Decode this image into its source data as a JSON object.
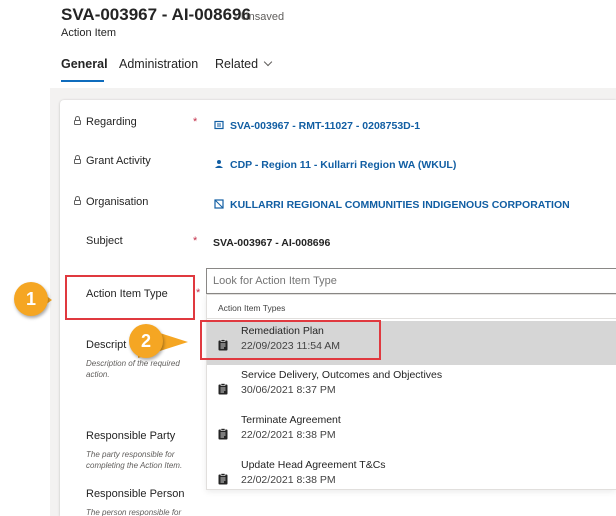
{
  "record": {
    "title": "SVA-003967 - AI-008696",
    "status": "- Unsaved",
    "entity": "Action Item"
  },
  "tabs": [
    {
      "label": "General"
    },
    {
      "label": "Administration"
    },
    {
      "label": "Related"
    }
  ],
  "fields": {
    "regarding": {
      "label": "Regarding",
      "value": "SVA-003967 - RMT-11027 - 0208753D-1",
      "icon": "record-icon"
    },
    "grant_activity": {
      "label": "Grant Activity",
      "value": "CDP - Region 11 - Kullarri Region WA (WKUL)",
      "icon": "people-icon"
    },
    "organisation": {
      "label": "Organisation",
      "value": "KULLARRI REGIONAL COMMUNITIES INDIGENOUS CORPORATION",
      "icon": "building-icon"
    },
    "subject": {
      "label": "Subject",
      "value": "SVA-003967 - AI-008696"
    },
    "action_item_type": {
      "label": "Action Item Type"
    },
    "description": {
      "label": "Descript",
      "help": "Description of the required action."
    },
    "responsible_party": {
      "label": "Responsible Party",
      "help": "The party responsible for completing the Action Item."
    },
    "responsible_person": {
      "label": "Responsible Person",
      "help": "The person responsible for"
    }
  },
  "required_marker": "*",
  "lookup": {
    "placeholder": "Look for Action Item Type",
    "header": "Action Item Types",
    "options": [
      {
        "name": "Remediation Plan",
        "date": "22/09/2023 11:54 AM",
        "selected": true
      },
      {
        "name": "Service Delivery, Outcomes and Objectives",
        "date": "30/06/2021 8:37 PM",
        "selected": false
      },
      {
        "name": "Terminate Agreement",
        "date": "22/02/2021 8:38 PM",
        "selected": false
      },
      {
        "name": "Update Head Agreement T&Cs",
        "date": "22/02/2021 8:38 PM",
        "selected": false
      }
    ]
  },
  "callouts": [
    {
      "number": "1"
    },
    {
      "number": "2"
    }
  ],
  "colors": {
    "accent": "#0f6cbd",
    "link": "#115ea3",
    "required": "#c4314b",
    "highlight": "#e0393f",
    "callout": "#f5a623"
  }
}
